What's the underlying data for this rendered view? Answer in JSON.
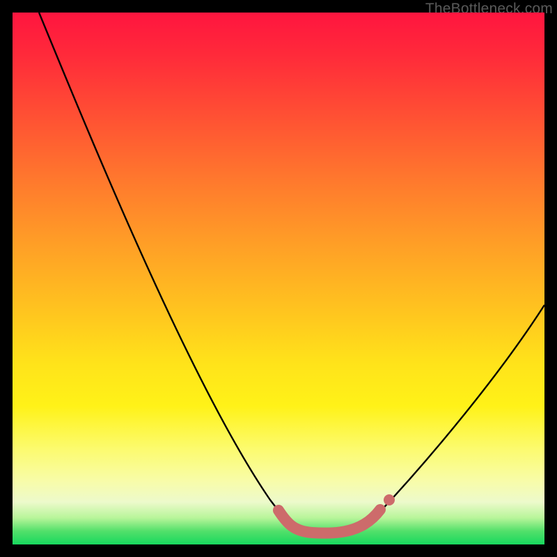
{
  "watermark": "TheBottleneck.com",
  "chart_data": {
    "type": "line",
    "title": "",
    "xlabel": "",
    "ylabel": "",
    "xlim": [
      0,
      100
    ],
    "ylim": [
      0,
      100
    ],
    "grid": false,
    "legend": false,
    "series": [
      {
        "name": "curve",
        "x": [
          5,
          10,
          15,
          20,
          25,
          30,
          35,
          40,
          45,
          50,
          52,
          54,
          56,
          58,
          60,
          62,
          64,
          66,
          68,
          70,
          75,
          80,
          85,
          90,
          95,
          100
        ],
        "y": [
          100,
          89,
          78,
          67,
          56,
          45,
          34,
          24,
          15,
          8,
          5,
          3.5,
          2.8,
          2.5,
          2.5,
          2.6,
          3.0,
          3.8,
          5.0,
          7,
          13,
          20,
          28,
          36,
          45,
          55
        ]
      },
      {
        "name": "highlight",
        "x": [
          51,
          53,
          55,
          57,
          59,
          61,
          63,
          65,
          67,
          69
        ],
        "y": [
          6,
          4,
          3.2,
          2.7,
          2.5,
          2.6,
          3.0,
          3.7,
          4.8,
          6.2
        ]
      }
    ],
    "annotations": []
  },
  "colors": {
    "curve": "#000000",
    "highlight": "#cd6b6b",
    "background_top": "#ff153f",
    "background_bottom": "#17d85e"
  }
}
